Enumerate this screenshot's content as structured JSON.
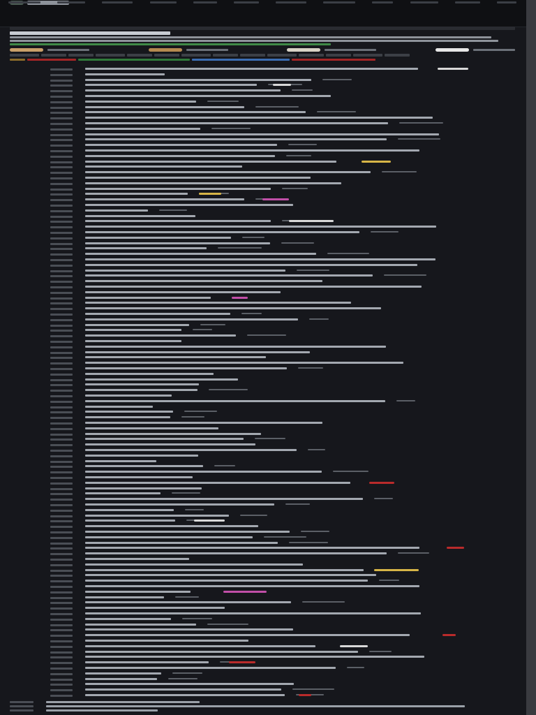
{
  "window": {
    "title": ""
  },
  "topbar": {
    "brand_label": "",
    "nav_items": [
      "",
      "",
      "",
      "",
      "",
      "",
      "",
      "",
      "",
      "",
      "",
      ""
    ],
    "right_actions": [
      "",
      "",
      ""
    ]
  },
  "summary": {
    "breadcrumb": "",
    "title": "",
    "description_lines": [
      "",
      "",
      ""
    ],
    "highlight_note": "",
    "chips": [
      {
        "label": "",
        "color": "#c9a06a"
      },
      {
        "label": "",
        "color": "#b58a50"
      },
      {
        "label": "",
        "color": "#d8d3c6"
      },
      {
        "label": "",
        "color": "#e7e7e7"
      }
    ],
    "legend_cells": [
      "",
      "",
      "",
      "",
      "",
      "",
      "",
      "",
      "",
      "",
      "",
      "",
      "",
      ""
    ],
    "status_segments": [
      {
        "label": "",
        "color": "#8b6b2a"
      },
      {
        "label": "",
        "color": "#a32626"
      },
      {
        "label": "",
        "color": "#2f7a3a"
      },
      {
        "label": "",
        "color": "#3b6db3"
      },
      {
        "label": "",
        "color": "#a32626"
      }
    ]
  },
  "list": {
    "rows": [
      {
        "num": "",
        "title": "",
        "meta": ""
      },
      {
        "num": "",
        "title": "",
        "meta": ""
      },
      {
        "num": "",
        "title": "",
        "meta": ""
      },
      {
        "num": "",
        "title": "",
        "meta": ""
      },
      {
        "num": "",
        "title": "",
        "meta": ""
      },
      {
        "num": "",
        "title": "",
        "meta": ""
      },
      {
        "num": "",
        "title": "",
        "meta": ""
      },
      {
        "num": "",
        "title": "",
        "meta": ""
      },
      {
        "num": "",
        "title": "",
        "meta": ""
      },
      {
        "num": "",
        "title": "",
        "meta": ""
      },
      {
        "num": "",
        "title": "",
        "meta": ""
      },
      {
        "num": "",
        "title": "",
        "meta": ""
      },
      {
        "num": "",
        "title": "",
        "meta": ""
      },
      {
        "num": "",
        "title": "",
        "meta": ""
      },
      {
        "num": "",
        "title": "",
        "meta": ""
      },
      {
        "num": "",
        "title": "",
        "meta": ""
      },
      {
        "num": "",
        "title": "",
        "meta": ""
      },
      {
        "num": "",
        "title": "",
        "meta": ""
      },
      {
        "num": "",
        "title": "",
        "meta": ""
      },
      {
        "num": "",
        "title": "",
        "meta": ""
      }
    ],
    "highlight_colors": [
      "#d7b547",
      "#b92b2b",
      "#c14fa8",
      "#d8d8d8"
    ]
  },
  "footer": {
    "lines": [
      {
        "num": "",
        "text": ""
      },
      {
        "num": "",
        "text": ""
      },
      {
        "num": "",
        "text": ""
      }
    ]
  }
}
